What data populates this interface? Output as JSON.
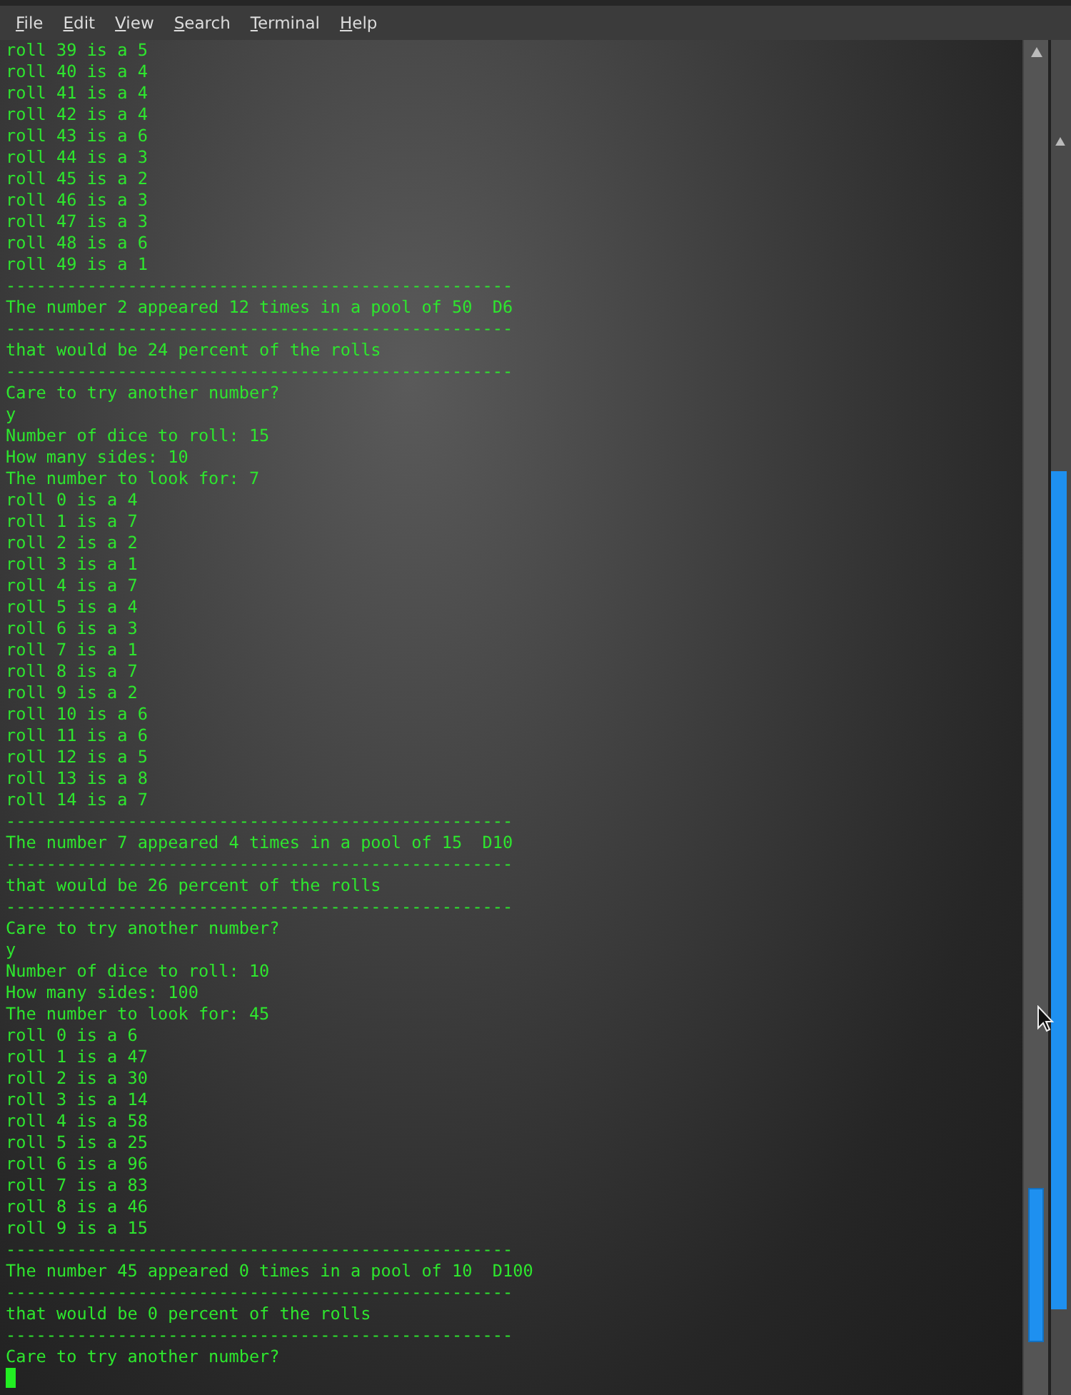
{
  "menu": [
    {
      "label": "File"
    },
    {
      "label": "Edit"
    },
    {
      "label": "View"
    },
    {
      "label": "Search"
    },
    {
      "label": "Terminal"
    },
    {
      "label": "Help"
    }
  ],
  "lines": [
    {
      "kind": "text",
      "text": "roll 39 is a 5"
    },
    {
      "kind": "text",
      "text": "roll 40 is a 4"
    },
    {
      "kind": "text",
      "text": "roll 41 is a 4"
    },
    {
      "kind": "text",
      "text": "roll 42 is a 4"
    },
    {
      "kind": "text",
      "text": "roll 43 is a 6"
    },
    {
      "kind": "text",
      "text": "roll 44 is a 3"
    },
    {
      "kind": "text",
      "text": "roll 45 is a 2"
    },
    {
      "kind": "text",
      "text": "roll 46 is a 3"
    },
    {
      "kind": "text",
      "text": "roll 47 is a 3"
    },
    {
      "kind": "text",
      "text": "roll 48 is a 6"
    },
    {
      "kind": "text",
      "text": "roll 49 is a 1"
    },
    {
      "kind": "rule",
      "text": "--------------------------------------------------"
    },
    {
      "kind": "text",
      "text": "The number 2 appeared 12 times in a pool of 50  D6"
    },
    {
      "kind": "rule",
      "text": "--------------------------------------------------"
    },
    {
      "kind": "text",
      "text": "that would be 24 percent of the rolls"
    },
    {
      "kind": "rule",
      "text": "--------------------------------------------------"
    },
    {
      "kind": "text",
      "text": "Care to try another number?"
    },
    {
      "kind": "text",
      "text": "y"
    },
    {
      "kind": "text",
      "text": "Number of dice to roll: 15"
    },
    {
      "kind": "text",
      "text": "How many sides: 10"
    },
    {
      "kind": "text",
      "text": "The number to look for: 7"
    },
    {
      "kind": "text",
      "text": "roll 0 is a 4"
    },
    {
      "kind": "text",
      "text": "roll 1 is a 7"
    },
    {
      "kind": "text",
      "text": "roll 2 is a 2"
    },
    {
      "kind": "text",
      "text": "roll 3 is a 1"
    },
    {
      "kind": "text",
      "text": "roll 4 is a 7"
    },
    {
      "kind": "text",
      "text": "roll 5 is a 4"
    },
    {
      "kind": "text",
      "text": "roll 6 is a 3"
    },
    {
      "kind": "text",
      "text": "roll 7 is a 1"
    },
    {
      "kind": "text",
      "text": "roll 8 is a 7"
    },
    {
      "kind": "text",
      "text": "roll 9 is a 2"
    },
    {
      "kind": "text",
      "text": "roll 10 is a 6"
    },
    {
      "kind": "text",
      "text": "roll 11 is a 6"
    },
    {
      "kind": "text",
      "text": "roll 12 is a 5"
    },
    {
      "kind": "text",
      "text": "roll 13 is a 8"
    },
    {
      "kind": "text",
      "text": "roll 14 is a 7"
    },
    {
      "kind": "rule",
      "text": "--------------------------------------------------"
    },
    {
      "kind": "text",
      "text": "The number 7 appeared 4 times in a pool of 15  D10"
    },
    {
      "kind": "rule",
      "text": "--------------------------------------------------"
    },
    {
      "kind": "text",
      "text": "that would be 26 percent of the rolls"
    },
    {
      "kind": "rule",
      "text": "--------------------------------------------------"
    },
    {
      "kind": "text",
      "text": "Care to try another number?"
    },
    {
      "kind": "text",
      "text": "y"
    },
    {
      "kind": "text",
      "text": "Number of dice to roll: 10"
    },
    {
      "kind": "text",
      "text": "How many sides: 100"
    },
    {
      "kind": "text",
      "text": "The number to look for: 45"
    },
    {
      "kind": "text",
      "text": "roll 0 is a 6"
    },
    {
      "kind": "text",
      "text": "roll 1 is a 47"
    },
    {
      "kind": "text",
      "text": "roll 2 is a 30"
    },
    {
      "kind": "text",
      "text": "roll 3 is a 14"
    },
    {
      "kind": "text",
      "text": "roll 4 is a 58"
    },
    {
      "kind": "text",
      "text": "roll 5 is a 25"
    },
    {
      "kind": "text",
      "text": "roll 6 is a 96"
    },
    {
      "kind": "text",
      "text": "roll 7 is a 83"
    },
    {
      "kind": "text",
      "text": "roll 8 is a 46"
    },
    {
      "kind": "text",
      "text": "roll 9 is a 15"
    },
    {
      "kind": "rule",
      "text": "--------------------------------------------------"
    },
    {
      "kind": "text",
      "text": "The number 45 appeared 0 times in a pool of 10  D100"
    },
    {
      "kind": "rule",
      "text": "--------------------------------------------------"
    },
    {
      "kind": "text",
      "text": "that would be 0 percent of the rolls"
    },
    {
      "kind": "rule",
      "text": "--------------------------------------------------"
    },
    {
      "kind": "text",
      "text": "Care to try another number?"
    },
    {
      "kind": "cursor"
    }
  ]
}
